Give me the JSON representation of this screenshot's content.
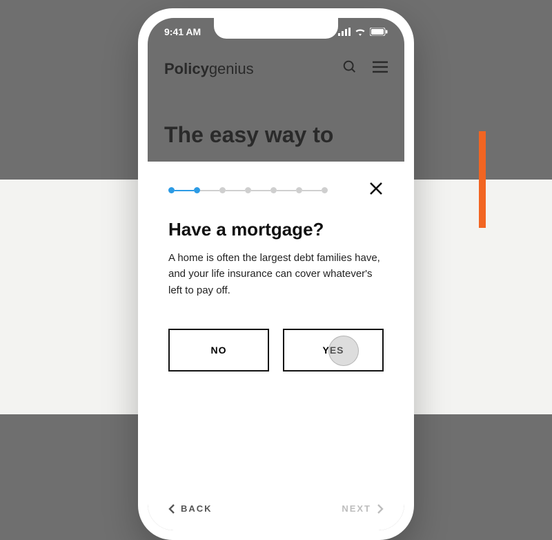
{
  "status": {
    "time": "9:41 AM"
  },
  "brand": {
    "part1": "Policy",
    "part2": "genius"
  },
  "hero": {
    "line": "The easy way to"
  },
  "modal": {
    "progress": {
      "total": 7,
      "current": 2
    },
    "title": "Have a mortgage?",
    "body": "A home is often the largest debt families have, and your life insurance can cover whatever's left to pay off.",
    "options": {
      "no": "NO",
      "yes": "YES"
    },
    "nav": {
      "back": "BACK",
      "next": "NEXT"
    }
  }
}
